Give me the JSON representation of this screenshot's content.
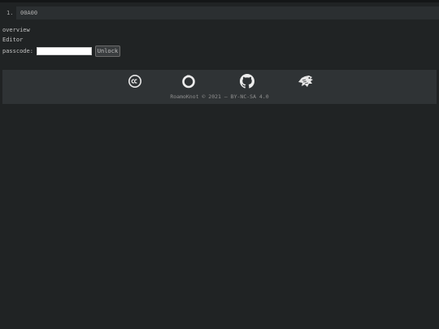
{
  "list": {
    "index": "1.",
    "entry": "00A00"
  },
  "nav": {
    "overview": "overview",
    "editor": "Editor"
  },
  "passcode": {
    "label": "passcode:",
    "value": "",
    "button": "Unlock"
  },
  "footer": {
    "icons": [
      "creative-commons-icon",
      "ring-icon",
      "github-icon",
      "bird-mascot-icon"
    ],
    "copyright": "RoamoKnot © 2021 — BY-NC-SA 4.0"
  },
  "colors": {
    "background": "#202324",
    "panel": "#2f3335",
    "text": "#c2c2c2"
  }
}
